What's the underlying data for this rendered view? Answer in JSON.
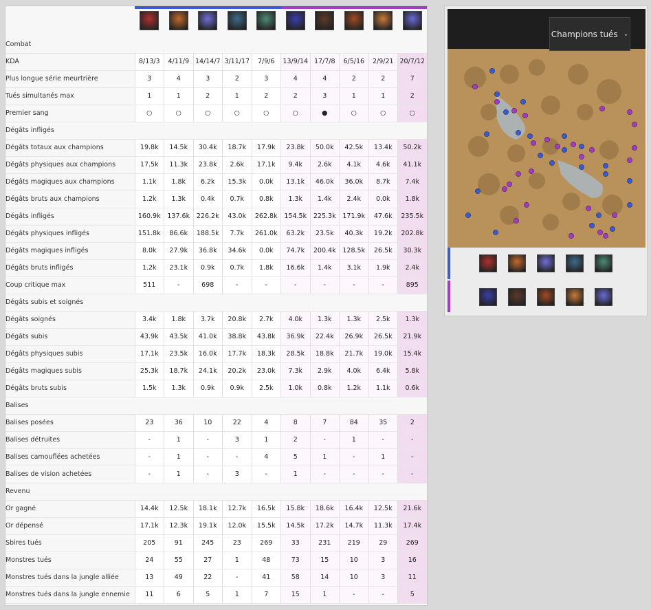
{
  "colors": {
    "team_blue": "#3a5bd0",
    "team_purple": "#a13bc4",
    "highlight_cell": "#f2dcef",
    "map_ground": "#b8925a"
  },
  "champions": [
    {
      "team": "blue",
      "icon": "champion-1-icon",
      "color": "#b03030"
    },
    {
      "team": "blue",
      "icon": "champion-2-icon",
      "color": "#c26a2c"
    },
    {
      "team": "blue",
      "icon": "champion-3-icon",
      "color": "#6f6fd6"
    },
    {
      "team": "blue",
      "icon": "champion-4-icon",
      "color": "#3f6a8a"
    },
    {
      "team": "blue",
      "icon": "champion-5-icon",
      "color": "#4e8a74"
    },
    {
      "team": "purple",
      "icon": "champion-6-icon",
      "color": "#3a3fa8"
    },
    {
      "team": "purple",
      "icon": "champion-7-icon",
      "color": "#5c3a2a"
    },
    {
      "team": "purple",
      "icon": "champion-8-icon",
      "color": "#a04a22"
    },
    {
      "team": "purple",
      "icon": "champion-9-icon",
      "color": "#c77a3a"
    },
    {
      "team": "purple",
      "icon": "champion-10-icon",
      "color": "#6a6ad6"
    }
  ],
  "sections": [
    {
      "title": "Combat",
      "rows": [
        {
          "label": "KDA",
          "values": [
            "8/13/3",
            "4/11/9",
            "14/14/7",
            "3/11/17",
            "7/9/6",
            "13/9/14",
            "17/7/8",
            "6/5/16",
            "2/9/21",
            "20/7/12"
          ]
        },
        {
          "label": "Plus longue série meurtrière",
          "values": [
            "3",
            "4",
            "3",
            "2",
            "3",
            "4",
            "4",
            "2",
            "2",
            "7"
          ]
        },
        {
          "label": "Tués simultanés max",
          "values": [
            "1",
            "1",
            "2",
            "1",
            "2",
            "2",
            "3",
            "1",
            "1",
            "2"
          ]
        },
        {
          "label": "Premier sang",
          "values": [
            "○",
            "○",
            "○",
            "○",
            "○",
            "○",
            "●",
            "○",
            "○",
            "○"
          ]
        }
      ]
    },
    {
      "title": "Dégâts infligés",
      "rows": [
        {
          "label": "Dégâts totaux aux champions",
          "values": [
            "19.8k",
            "14.5k",
            "30.4k",
            "18.7k",
            "17.9k",
            "23.8k",
            "50.0k",
            "42.5k",
            "13.4k",
            "50.2k"
          ]
        },
        {
          "label": "Dégâts physiques aux champions",
          "values": [
            "17.5k",
            "11.3k",
            "23.8k",
            "2.6k",
            "17.1k",
            "9.4k",
            "2.6k",
            "4.1k",
            "4.6k",
            "41.1k"
          ]
        },
        {
          "label": "Dégâts magiques aux champions",
          "values": [
            "1.1k",
            "1.8k",
            "6.2k",
            "15.3k",
            "0.0k",
            "13.1k",
            "46.0k",
            "36.0k",
            "8.7k",
            "7.4k"
          ]
        },
        {
          "label": "Dégâts bruts aux champions",
          "values": [
            "1.2k",
            "1.3k",
            "0.4k",
            "0.7k",
            "0.8k",
            "1.3k",
            "1.4k",
            "2.4k",
            "0.0k",
            "1.8k"
          ]
        },
        {
          "label": "Dégâts infligés",
          "values": [
            "160.9k",
            "137.6k",
            "226.2k",
            "43.0k",
            "262.8k",
            "154.5k",
            "225.3k",
            "171.9k",
            "47.6k",
            "235.5k"
          ]
        },
        {
          "label": "Dégâts physiques infligés",
          "values": [
            "151.8k",
            "86.6k",
            "188.5k",
            "7.7k",
            "261.0k",
            "63.2k",
            "23.5k",
            "40.3k",
            "19.2k",
            "202.8k"
          ]
        },
        {
          "label": "Dégâts magiques infligés",
          "values": [
            "8.0k",
            "27.9k",
            "36.8k",
            "34.6k",
            "0.0k",
            "74.7k",
            "200.4k",
            "128.5k",
            "26.5k",
            "30.3k"
          ]
        },
        {
          "label": "Dégâts bruts infligés",
          "values": [
            "1.2k",
            "23.1k",
            "0.9k",
            "0.7k",
            "1.8k",
            "16.6k",
            "1.4k",
            "3.1k",
            "1.9k",
            "2.4k"
          ]
        },
        {
          "label": "Coup critique max",
          "values": [
            "511",
            "-",
            "698",
            "-",
            "-",
            "-",
            "-",
            "-",
            "-",
            "895"
          ]
        }
      ]
    },
    {
      "title": "Dégâts subis et soignés",
      "rows": [
        {
          "label": "Dégâts soignés",
          "values": [
            "3.4k",
            "1.8k",
            "3.7k",
            "20.8k",
            "2.7k",
            "4.0k",
            "1.3k",
            "1.3k",
            "2.5k",
            "1.3k"
          ]
        },
        {
          "label": "Dégâts subis",
          "values": [
            "43.9k",
            "43.5k",
            "41.0k",
            "38.8k",
            "43.8k",
            "36.9k",
            "22.4k",
            "26.9k",
            "26.5k",
            "21.9k"
          ]
        },
        {
          "label": "Dégâts physiques subis",
          "values": [
            "17.1k",
            "23.5k",
            "16.0k",
            "17.7k",
            "18.3k",
            "28.5k",
            "18.8k",
            "21.7k",
            "19.0k",
            "15.4k"
          ]
        },
        {
          "label": "Dégâts magiques subis",
          "values": [
            "25.3k",
            "18.7k",
            "24.1k",
            "20.2k",
            "23.0k",
            "7.3k",
            "2.9k",
            "4.0k",
            "6.4k",
            "5.8k"
          ]
        },
        {
          "label": "Dégâts bruts subis",
          "values": [
            "1.5k",
            "1.3k",
            "0.9k",
            "0.9k",
            "2.5k",
            "1.0k",
            "0.8k",
            "1.2k",
            "1.1k",
            "0.6k"
          ]
        }
      ]
    },
    {
      "title": "Balises",
      "rows": [
        {
          "label": "Balises posées",
          "values": [
            "23",
            "36",
            "10",
            "22",
            "4",
            "8",
            "7",
            "84",
            "35",
            "2"
          ]
        },
        {
          "label": "Balises détruites",
          "values": [
            "-",
            "1",
            "-",
            "3",
            "1",
            "2",
            "-",
            "1",
            "-",
            "-"
          ]
        },
        {
          "label": "Balises camouflées achetées",
          "values": [
            "-",
            "1",
            "-",
            "-",
            "4",
            "5",
            "1",
            "-",
            "1",
            "-"
          ]
        },
        {
          "label": "Balises de vision achetées",
          "values": [
            "-",
            "1",
            "-",
            "3",
            "-",
            "1",
            "-",
            "-",
            "-",
            "-"
          ]
        }
      ]
    },
    {
      "title": "Revenu",
      "rows": [
        {
          "label": "Or gagné",
          "values": [
            "14.4k",
            "12.5k",
            "18.1k",
            "12.7k",
            "16.5k",
            "15.8k",
            "18.6k",
            "16.4k",
            "12.5k",
            "21.6k"
          ]
        },
        {
          "label": "Or dépensé",
          "values": [
            "17.1k",
            "12.3k",
            "19.1k",
            "12.0k",
            "15.5k",
            "14.5k",
            "17.2k",
            "14.7k",
            "11.3k",
            "17.4k"
          ]
        },
        {
          "label": "Sbires tués",
          "values": [
            "205",
            "91",
            "245",
            "23",
            "269",
            "33",
            "231",
            "219",
            "29",
            "269"
          ]
        },
        {
          "label": "Monstres tués",
          "values": [
            "24",
            "55",
            "27",
            "1",
            "48",
            "73",
            "15",
            "10",
            "3",
            "16"
          ]
        },
        {
          "label": "Monstres tués dans la jungle alliée",
          "values": [
            "13",
            "49",
            "22",
            "-",
            "41",
            "58",
            "14",
            "10",
            "3",
            "11"
          ]
        },
        {
          "label": "Monstres tués dans la jungle ennemie",
          "values": [
            "11",
            "6",
            "5",
            "1",
            "7",
            "15",
            "1",
            "-",
            "-",
            "5"
          ]
        }
      ]
    }
  ],
  "map": {
    "filter_label": "Champions tués",
    "filter_icon": "chevron-down-icon"
  }
}
